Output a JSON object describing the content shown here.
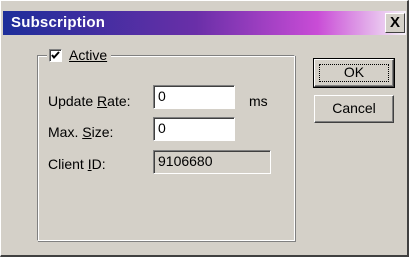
{
  "dialog": {
    "title": "Subscription",
    "close_glyph": "X"
  },
  "group": {
    "active_label": "Active",
    "active_checked": true
  },
  "fields": {
    "update_rate": {
      "label_pre": "Update ",
      "label_accel": "R",
      "label_post": "ate:",
      "value": "0",
      "unit": "ms"
    },
    "max_size": {
      "label_pre": "Max. ",
      "label_accel": "S",
      "label_post": "ize:",
      "value": "0"
    },
    "client_id": {
      "label_pre": "Client ",
      "label_accel": "I",
      "label_post": "D:",
      "value": "9106680"
    }
  },
  "buttons": {
    "ok": "OK",
    "cancel": "Cancel"
  },
  "colors": {
    "face": "#d4d0c8",
    "title_start": "#1d2e9a",
    "title_end": "#f5f1f8"
  }
}
